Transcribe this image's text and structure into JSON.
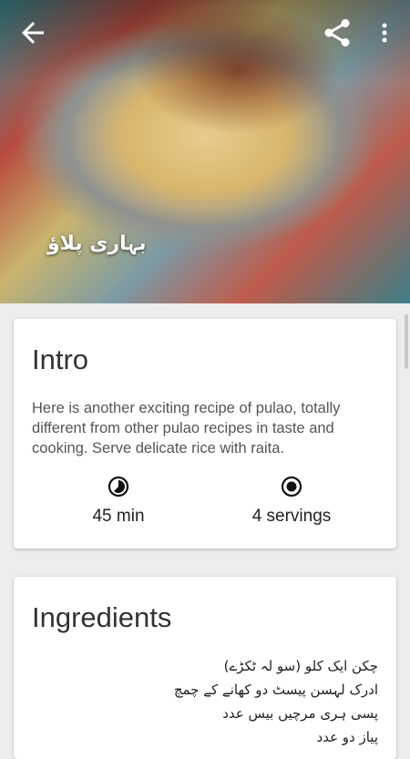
{
  "hero": {
    "title": "بہاری پلاؤ",
    "image_icon": "pulao-dish-photo"
  },
  "toolbar": {
    "back_icon": "arrow-left-icon",
    "share_icon": "share-icon",
    "more_icon": "more-vert-icon"
  },
  "intro": {
    "title": "Intro",
    "description": "Here is another exciting recipe of pulao, totally different from other pulao recipes in taste and cooking. Serve delicate rice with raita.",
    "time": "45 min",
    "time_icon": "timer-icon",
    "servings": "4 servings",
    "servings_icon": "servings-icon"
  },
  "ingredients": {
    "title": "Ingredients",
    "items": [
      "چکن ایک کلو (سو لہ ٹکڑے)",
      "ادرک لہسن پیسٹ دو کھانے کے چمچ",
      "پسی ہری مرچیں بیس عدد",
      "پیاز دو عدد"
    ]
  }
}
